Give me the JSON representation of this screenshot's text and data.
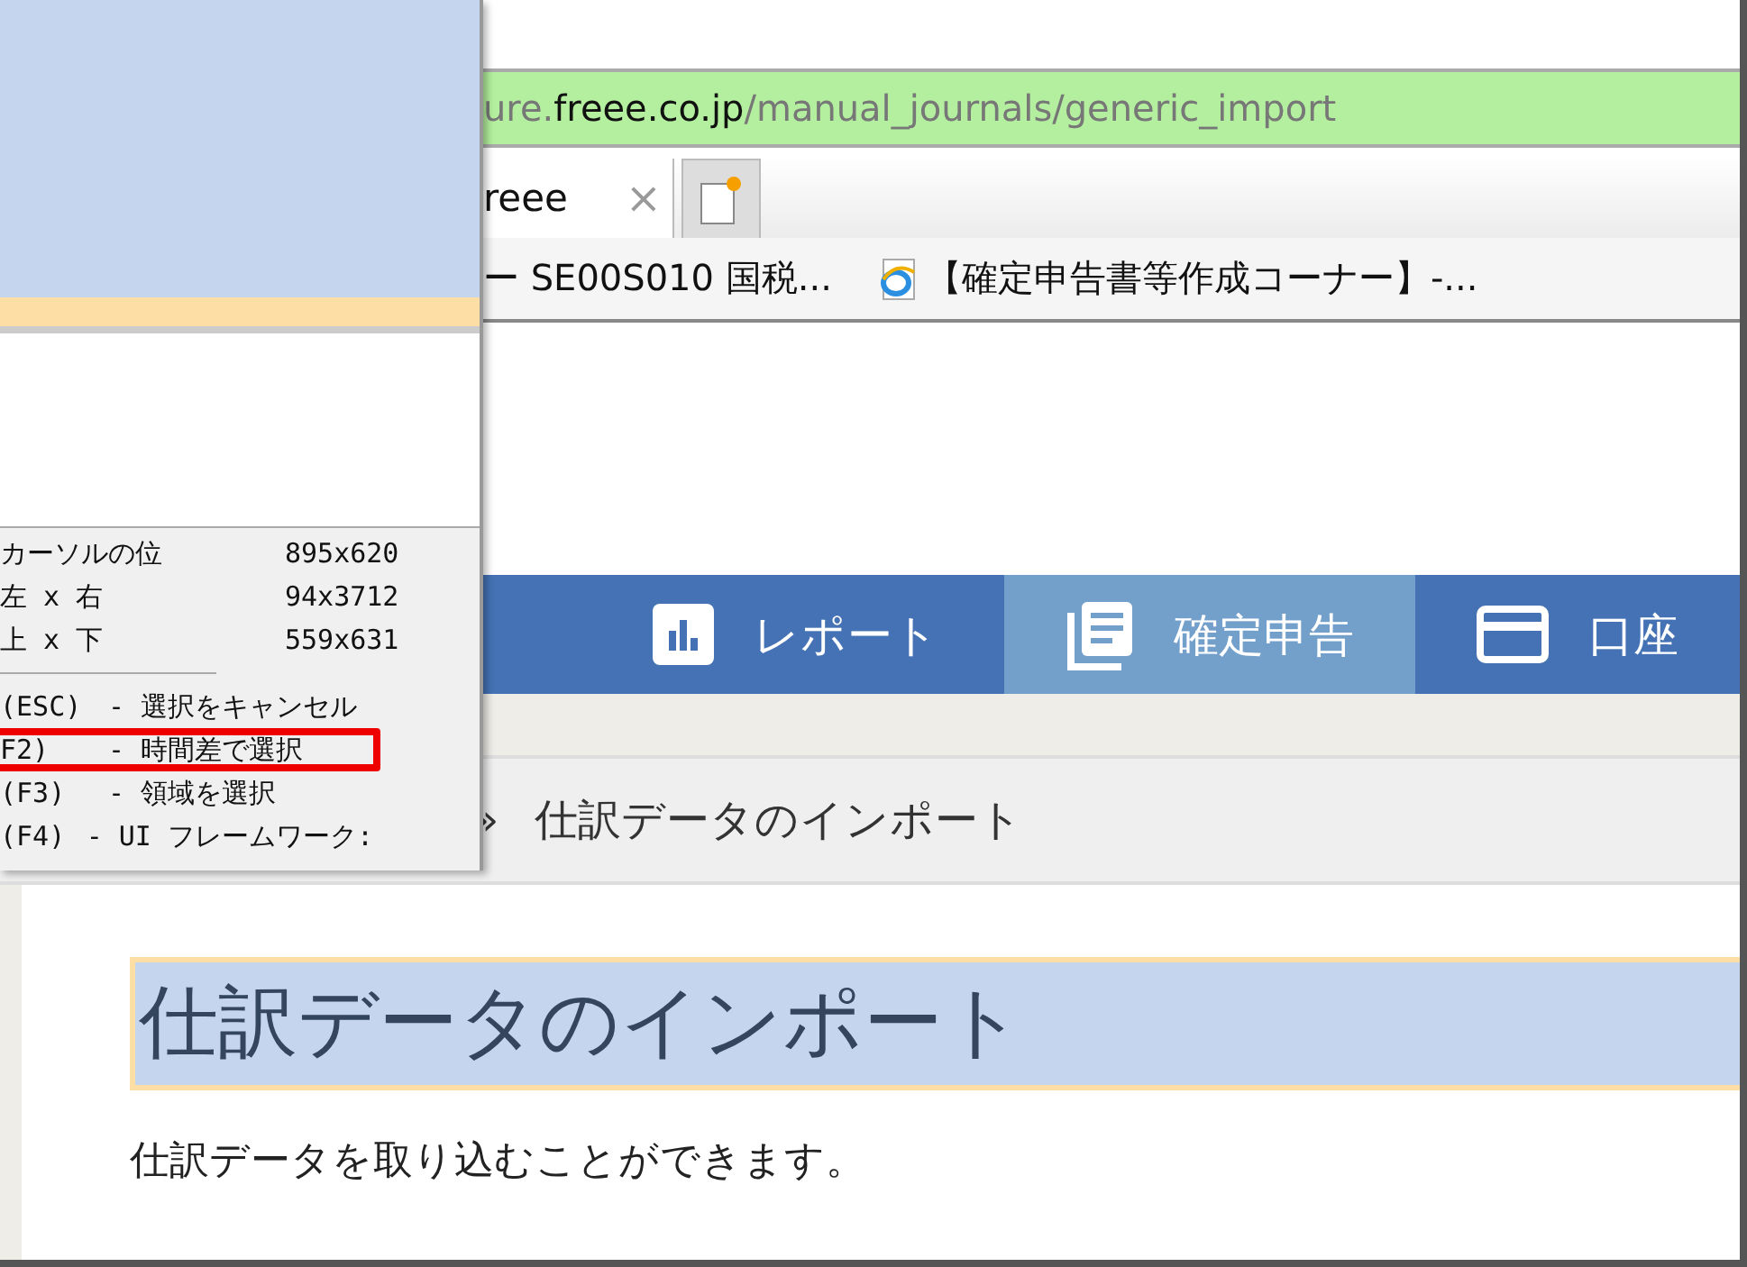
{
  "browser": {
    "address": {
      "host_prefix": "ure.",
      "host": "freee.co.jp",
      "path": "/manual_journals/generic_import"
    },
    "tabs": [
      {
        "title": "reee",
        "close": "×",
        "selected": true
      }
    ],
    "bookmarks": [
      {
        "label": "ー SE00S010 国税...",
        "kind": "plain"
      },
      {
        "label": "【確定申告書等作成コーナー】-...",
        "kind": "ie"
      }
    ]
  },
  "nav": [
    {
      "label": "レポート",
      "kind": "report",
      "selected": false
    },
    {
      "label": "確定申告",
      "kind": "tax",
      "selected": true
    },
    {
      "label": "口座",
      "kind": "account",
      "selected": false
    }
  ],
  "breadcrumb": {
    "separator": "»",
    "current": "仕訳データのインポート"
  },
  "heading": {
    "text": "仕訳データのインポート",
    "highlighted": true
  },
  "description": "仕訳データを取り込むことができます。",
  "capture_panel": {
    "info": [
      {
        "label": "カーソルの位",
        "value": "895x620"
      },
      {
        "label": "左 x 右",
        "value": "94x3712"
      },
      {
        "label": "上 x 下",
        "value": "559x631"
      }
    ],
    "shortcuts": [
      {
        "key": "(ESC)",
        "action": "- 選択をキャンセル",
        "highlighted": false
      },
      {
        "key": "F2)",
        "action": "- 時間差で選択",
        "highlighted": true
      },
      {
        "key": "(F3)",
        "action": "- 領域を選択",
        "highlighted": false
      },
      {
        "key": "(F4)",
        "action": "- UI フレームワーク:",
        "highlighted": false
      }
    ]
  }
}
